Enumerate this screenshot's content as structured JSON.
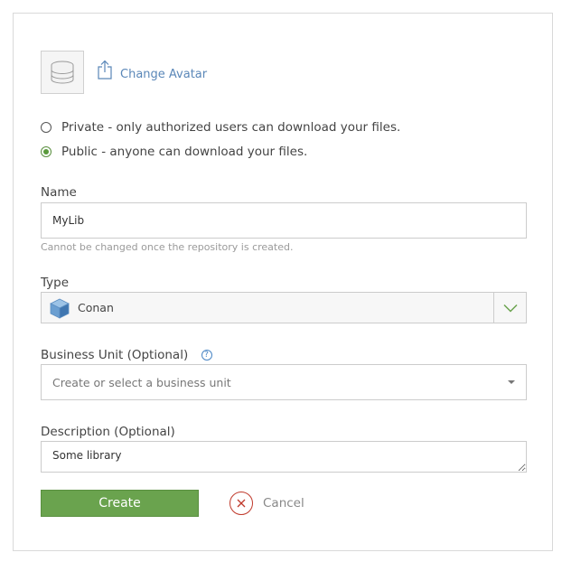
{
  "avatar": {
    "change_label": "Change Avatar"
  },
  "visibility": {
    "options": [
      {
        "label": "Private - only authorized users can download your files.",
        "checked": false
      },
      {
        "label": "Public - anyone can download your files.",
        "checked": true
      }
    ]
  },
  "name": {
    "label": "Name",
    "value": "MyLib",
    "hint": "Cannot be changed once the repository is created."
  },
  "type": {
    "label": "Type",
    "value": "Conan",
    "icon": "conan-package-icon"
  },
  "business_unit": {
    "label": "Business Unit (Optional)",
    "help_glyph": "?",
    "placeholder": "Create or select a business unit"
  },
  "description": {
    "label": "Description (Optional)",
    "value": "Some library"
  },
  "actions": {
    "create_label": "Create",
    "cancel_label": "Cancel"
  },
  "colors": {
    "accent_green": "#6aa34e",
    "link_blue": "#5a87b8",
    "cancel_red": "#c0392b"
  }
}
